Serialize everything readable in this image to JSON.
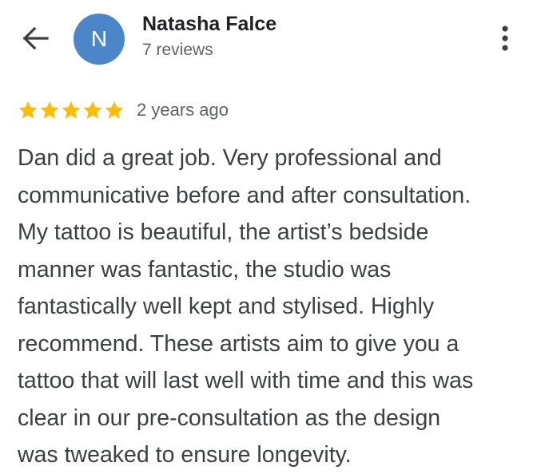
{
  "reviewer": {
    "avatar_letter": "N",
    "avatar_color": "#4a86c8",
    "name": "Natasha Falce",
    "review_count": "7 reviews"
  },
  "icons": {
    "back": "arrow-back-icon",
    "more": "more-vert-icon",
    "star": "star-icon"
  },
  "review": {
    "rating": 5,
    "max_rating": 5,
    "star_color": "#fbbc04",
    "date": "2 years ago",
    "text_lines": [
      "Dan did a great job. Very professional and",
      "communicative before and after consultation.",
      "My tattoo is beautiful, the artist’s bedside",
      "manner was fantastic, the studio was",
      "fantastically well kept and stylised. Highly",
      "recommend. These artists aim to give you a",
      "tattoo that will last well with time and this was",
      "clear in our pre-consultation as the design",
      "was tweaked to ensure longevity."
    ]
  }
}
